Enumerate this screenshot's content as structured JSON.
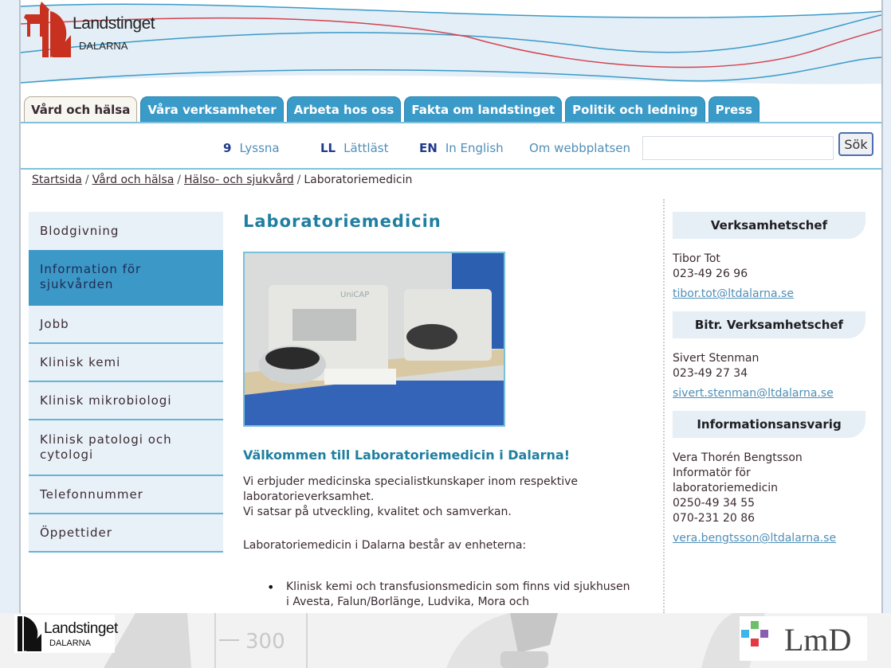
{
  "header": {
    "logo_name": "Landstinget",
    "logo_sub": "DALARNA",
    "colors": {
      "brand_red": "#c8311f",
      "wave_blue": "#3a9ac8",
      "banner_bg": "#e3eef7"
    }
  },
  "tabs": [
    {
      "label": "Vård och hälsa",
      "active": true
    },
    {
      "label": "Våra verksamheter",
      "active": false
    },
    {
      "label": "Arbeta hos oss",
      "active": false
    },
    {
      "label": "Fakta om landstinget",
      "active": false
    },
    {
      "label": "Politik och ledning",
      "active": false
    },
    {
      "label": "Press",
      "active": false
    }
  ],
  "utility": {
    "listen": {
      "icon": "ear-icon",
      "glyph": "9",
      "label": "Lyssna"
    },
    "easy_read": {
      "icon": "easy-read-icon",
      "glyph": "LL",
      "label": "Lättläst"
    },
    "english": {
      "icon": "en-flag-icon",
      "glyph": "EN",
      "label": "In English"
    },
    "about": {
      "label": "Om webbplatsen"
    },
    "search": {
      "value": "",
      "placeholder": "",
      "button": "Sök"
    }
  },
  "breadcrumb": {
    "items": [
      "Startsida",
      "Vård och hälsa",
      "Hälso- och sjukvård"
    ],
    "current": "Laboratoriemedicin",
    "separator": "/"
  },
  "leftnav": {
    "items": [
      {
        "label": "Blodgivning",
        "active": false
      },
      {
        "label": "Information för sjukvården",
        "active": true
      },
      {
        "label": "Jobb",
        "active": false
      },
      {
        "label": "Klinisk kemi",
        "active": false
      },
      {
        "label": "Klinisk mikrobiologi",
        "active": false
      },
      {
        "label": "Klinisk patologi och cytologi",
        "active": false
      },
      {
        "label": "Telefonnummer",
        "active": false
      },
      {
        "label": "Öppettider",
        "active": false
      }
    ]
  },
  "main": {
    "title": "Laboratoriemedicin",
    "photo_alt": "Laboratory analysers (UniCAP) on a bench",
    "photo_label": "UniCAP",
    "welcome": "Välkommen till Laboratoriemedicin i Dalarna!",
    "para_line1": "Vi erbjuder medicinska specialistkunskaper inom respektive laboratorieverksamhet.",
    "para_line2": "Vi satsar på utveckling, kvalitet och samverkan.",
    "units_intro": "Laboratoriemedicin i Dalarna består av enheterna:",
    "units": [
      "Klinisk kemi och transfusionsmedicin som finns vid sjukhusen i Avesta, Falun/Borlänge, Ludvika, Mora och"
    ]
  },
  "sidebar": {
    "sections": [
      {
        "heading": "Verksamhetschef",
        "lines": [
          "Tibor Tot",
          "023-49 26 96"
        ],
        "email": "tibor.tot@ltdalarna.se"
      },
      {
        "heading": "Bitr. Verksamhetschef",
        "lines": [
          "Sivert Stenman",
          "023-49 27 34"
        ],
        "email": "sivert.stenman@ltdalarna.se"
      },
      {
        "heading": "Informationsansvarig",
        "lines": [
          "Vera Thorén Bengtsson",
          "Informatör för",
          "laboratoriemedicin",
          "0250-49 34 55",
          "070-231 20 86"
        ],
        "email": "vera.bengtsson@ltdalarna.se"
      }
    ]
  },
  "footer": {
    "logo_name": "Landstinget",
    "logo_sub": "DALARNA",
    "partner_logo": "LmD",
    "bg_text": "300"
  }
}
